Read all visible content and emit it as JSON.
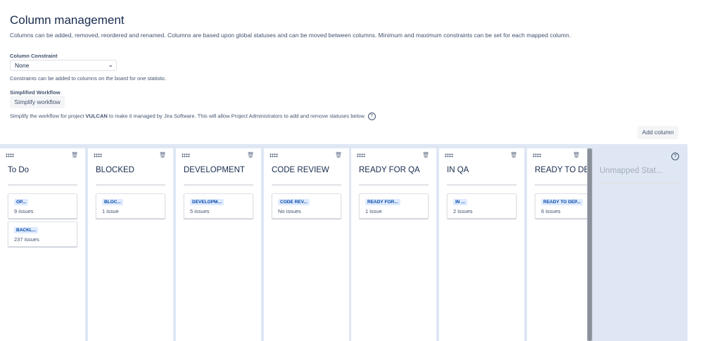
{
  "page": {
    "title": "Column management",
    "description": "Columns can be added, removed, reordered and renamed. Columns are based upon global statuses and can be moved between columns. Minimum and maximum constraints can be set for each mapped column."
  },
  "constraint": {
    "label": "Column Constraint",
    "value": "None",
    "help": "Constraints can be added to columns on the board for one statistic."
  },
  "workflow": {
    "label": "Simplified Workflow",
    "button": "Simplify workflow",
    "help_before": "Simplify the workflow for project ",
    "project": "VULCAN",
    "help_after": " to make it managed by Jira Software. This will allow Project Administrators to add and remove statuses below."
  },
  "add_column": "Add column",
  "columns": [
    {
      "title": "To Do",
      "cards": [
        {
          "status": "OP...",
          "count": "9 issues"
        },
        {
          "status": "BACKL...",
          "count": "237 issues"
        }
      ]
    },
    {
      "title": "BLOCKED",
      "cards": [
        {
          "status": "BLOC...",
          "count": "1 issue"
        }
      ]
    },
    {
      "title": "DEVELOPMENT",
      "cards": [
        {
          "status": "DEVELOPM...",
          "count": "5 issues"
        }
      ]
    },
    {
      "title": "CODE REVIEW",
      "cards": [
        {
          "status": "CODE REV...",
          "count": "No issues"
        }
      ]
    },
    {
      "title": "READY FOR QA",
      "cards": [
        {
          "status": "READY FOR...",
          "count": "1 issue"
        }
      ]
    },
    {
      "title": "IN QA",
      "cards": [
        {
          "status": "IN ...",
          "count": "2 issues"
        }
      ]
    },
    {
      "title": "READY TO DE",
      "cards": [
        {
          "status": "READY TO DEP...",
          "count": "6 issues"
        }
      ]
    }
  ],
  "unmapped": {
    "title": "Unmapped Stat..."
  },
  "icons": {
    "drag": "drag-handle-icon",
    "trash": "trash-icon",
    "help": "question-circle-icon"
  },
  "colors": {
    "board_bg": "#dfe7f5",
    "tag_bg": "#deebff",
    "tag_text": "#0747a6"
  }
}
